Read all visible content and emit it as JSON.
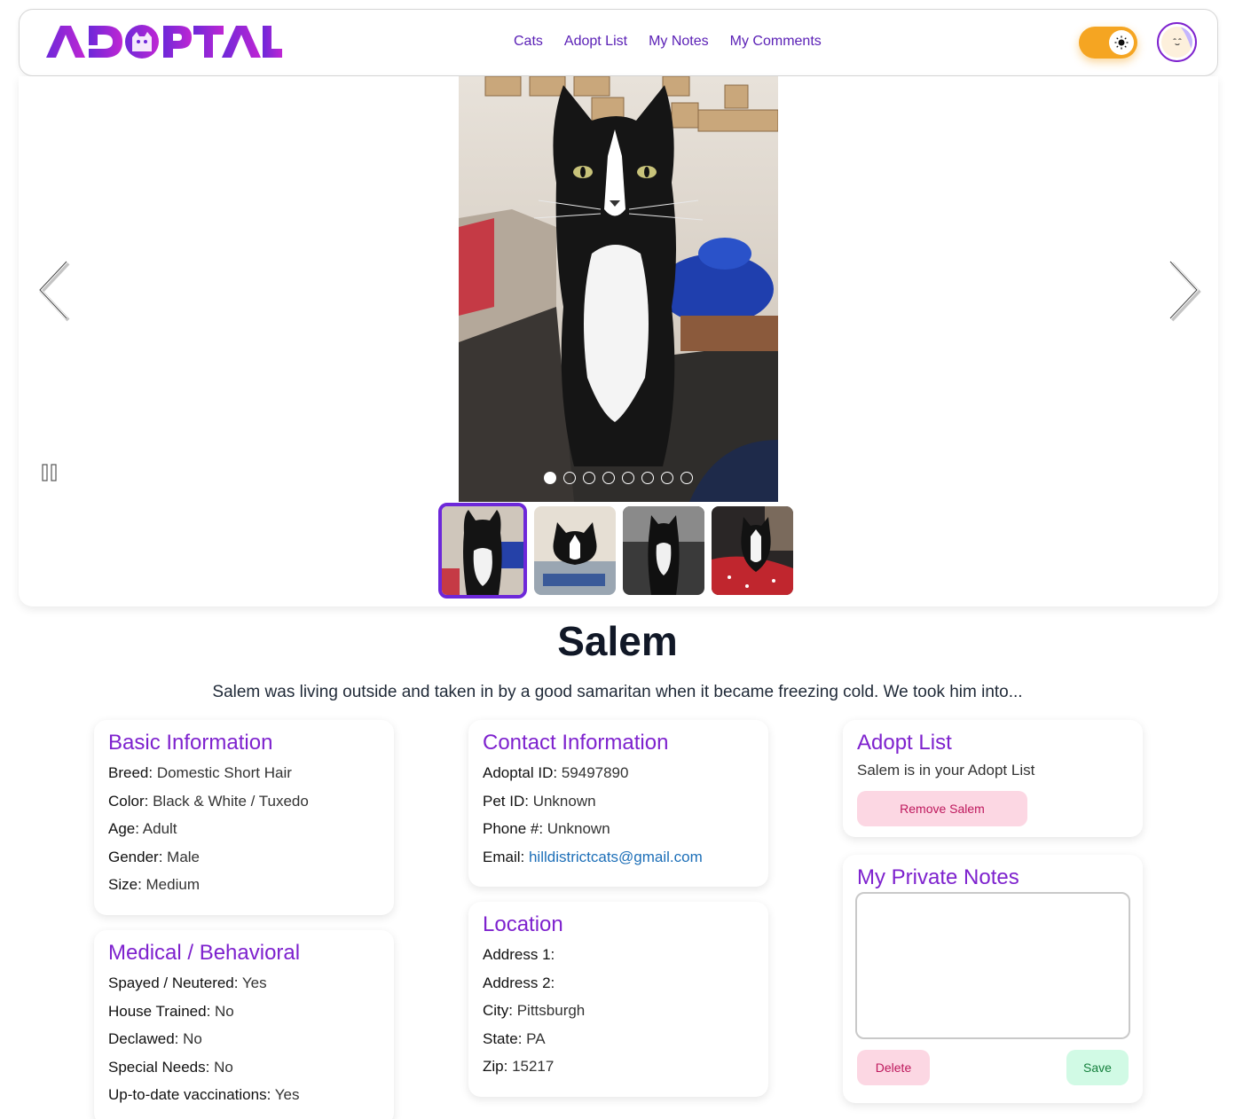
{
  "app": {
    "logo_text": "ADOPTAL",
    "brand_gradient": [
      "#6d28d9",
      "#c026d3"
    ]
  },
  "nav": {
    "links": [
      "Cats",
      "Adopt List",
      "My Notes",
      "My Comments"
    ]
  },
  "theme_toggle": {
    "icon": "sun-icon",
    "state": "light",
    "color": "#f5a522"
  },
  "avatar": {
    "icon": "avatar-face-icon"
  },
  "carousel": {
    "slide_count": 8,
    "active_index": 0,
    "thumbnail_count": 4,
    "active_thumbnail": 0,
    "prev_icon": "chevron-left-icon",
    "next_icon": "chevron-right-icon",
    "pause_icon": "pause-icon"
  },
  "pet": {
    "name": "Salem",
    "description": "Salem was living outside and taken in by a good samaritan when it became freezing cold. We took him into..."
  },
  "basic_info": {
    "title": "Basic Information",
    "rows": [
      {
        "label": "Breed:",
        "value": " Domestic Short Hair"
      },
      {
        "label": "Color:",
        "value": " Black & White / Tuxedo"
      },
      {
        "label": "Age:",
        "value": " Adult"
      },
      {
        "label": "Gender:",
        "value": " Male"
      },
      {
        "label": "Size:",
        "value": " Medium"
      }
    ]
  },
  "medical": {
    "title": "Medical / Behavioral",
    "rows": [
      {
        "label": "Spayed / Neutered:",
        "value": " Yes"
      },
      {
        "label": "House Trained:",
        "value": " No"
      },
      {
        "label": "Declawed:",
        "value": " No"
      },
      {
        "label": "Special Needs:",
        "value": " No"
      },
      {
        "label": "Up-to-date vaccinations:",
        "value": " Yes"
      }
    ]
  },
  "contact": {
    "title": "Contact Information",
    "rows": [
      {
        "label": "Adoptal ID:",
        "value": " 59497890"
      },
      {
        "label": "Pet ID:",
        "value": " Unknown"
      },
      {
        "label": "Phone #:",
        "value": " Unknown"
      }
    ],
    "email_label": "Email:",
    "email": "hilldistrictcats@gmail.com"
  },
  "location": {
    "title": "Location",
    "rows": [
      {
        "label": "Address 1:",
        "value": ""
      },
      {
        "label": "Address 2:",
        "value": ""
      },
      {
        "label": "City:",
        "value": " Pittsburgh"
      },
      {
        "label": "State:",
        "value": " PA"
      },
      {
        "label": "Zip:",
        "value": " 15217"
      }
    ]
  },
  "adopt_list": {
    "title": "Adopt List",
    "status": "Salem is in your Adopt List",
    "remove_label": "Remove Salem"
  },
  "private_notes": {
    "title": "My Private Notes",
    "value": "",
    "delete_label": "Delete",
    "save_label": "Save"
  }
}
